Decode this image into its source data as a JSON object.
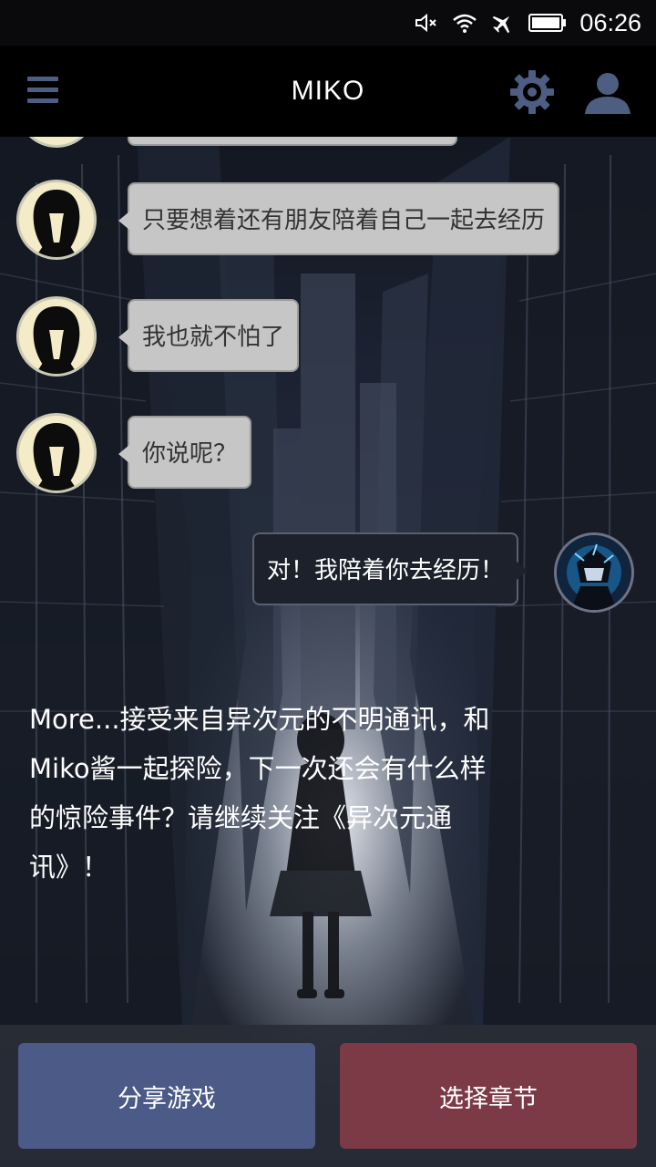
{
  "status_bar": {
    "time": "06:26",
    "icons": [
      "mute-icon",
      "wifi-icon",
      "airplane-icon",
      "battery-icon"
    ]
  },
  "header": {
    "title": "MIKO",
    "icons": [
      "menu-icon",
      "gear-icon",
      "user-icon"
    ],
    "accent_color": "#4e5e82"
  },
  "chat": {
    "messages": [
      {
        "sender": "miko",
        "text": "只要想着还有朋友陪着自己一起去经历"
      },
      {
        "sender": "miko",
        "text": "我也就不怕了"
      },
      {
        "sender": "miko",
        "text": "你说呢？"
      },
      {
        "sender": "player",
        "text": "对！我陪着你去经历！"
      }
    ]
  },
  "more_text": "More...接受来自异次元的不明通讯，和Miko酱一起探险，下一次还会有什么样的惊险事件？请继续关注《异次元通讯》！",
  "buttons": {
    "share": "分享游戏",
    "chapter": "选择章节",
    "share_color": "#4b5a86",
    "chapter_color": "#7b3a46"
  }
}
